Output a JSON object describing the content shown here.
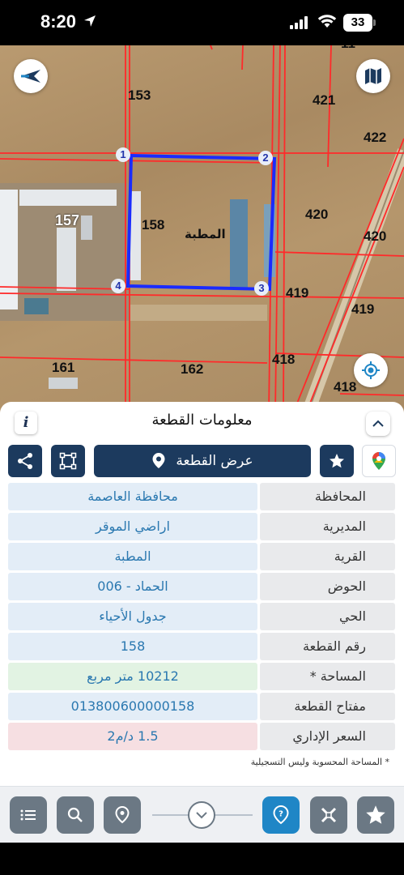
{
  "status_bar": {
    "time": "8:20",
    "battery": "33"
  },
  "map": {
    "parcel_labels": [
      "153",
      "421",
      "422",
      "157",
      "158",
      "420",
      "420",
      "419",
      "419",
      "418",
      "161",
      "162",
      "418",
      "11"
    ],
    "village_label": "المطبة",
    "vertices": [
      "1",
      "2",
      "3",
      "4"
    ]
  },
  "sheet": {
    "title": "معلومات القطعة",
    "info_icon": "i",
    "view_button": "عرض القطعة",
    "rows": [
      {
        "key": "المحافظة",
        "value": "محافظة العاصمة"
      },
      {
        "key": "المديرية",
        "value": "اراضي الموقر"
      },
      {
        "key": "القرية",
        "value": "المطبة"
      },
      {
        "key": "الحوض",
        "value": "الحماد - 006"
      },
      {
        "key": "الحي",
        "value": "جدول الأحياء"
      },
      {
        "key": "رقم القطعة",
        "value": "158"
      },
      {
        "key": "المساحة *",
        "value": "10212  متر مربع"
      },
      {
        "key": "مفتاح القطعة",
        "value": "013800600000158"
      },
      {
        "key": "السعر الإداري",
        "value": "1.5 د/م2"
      }
    ],
    "footnote": "* المساحة المحسوبة وليس التسجيلية"
  },
  "colors": {
    "primary": "#1c3a5e",
    "accent": "#1f86c6",
    "parcel_line": "#ff2a2a",
    "selection": "#1a2bff"
  }
}
